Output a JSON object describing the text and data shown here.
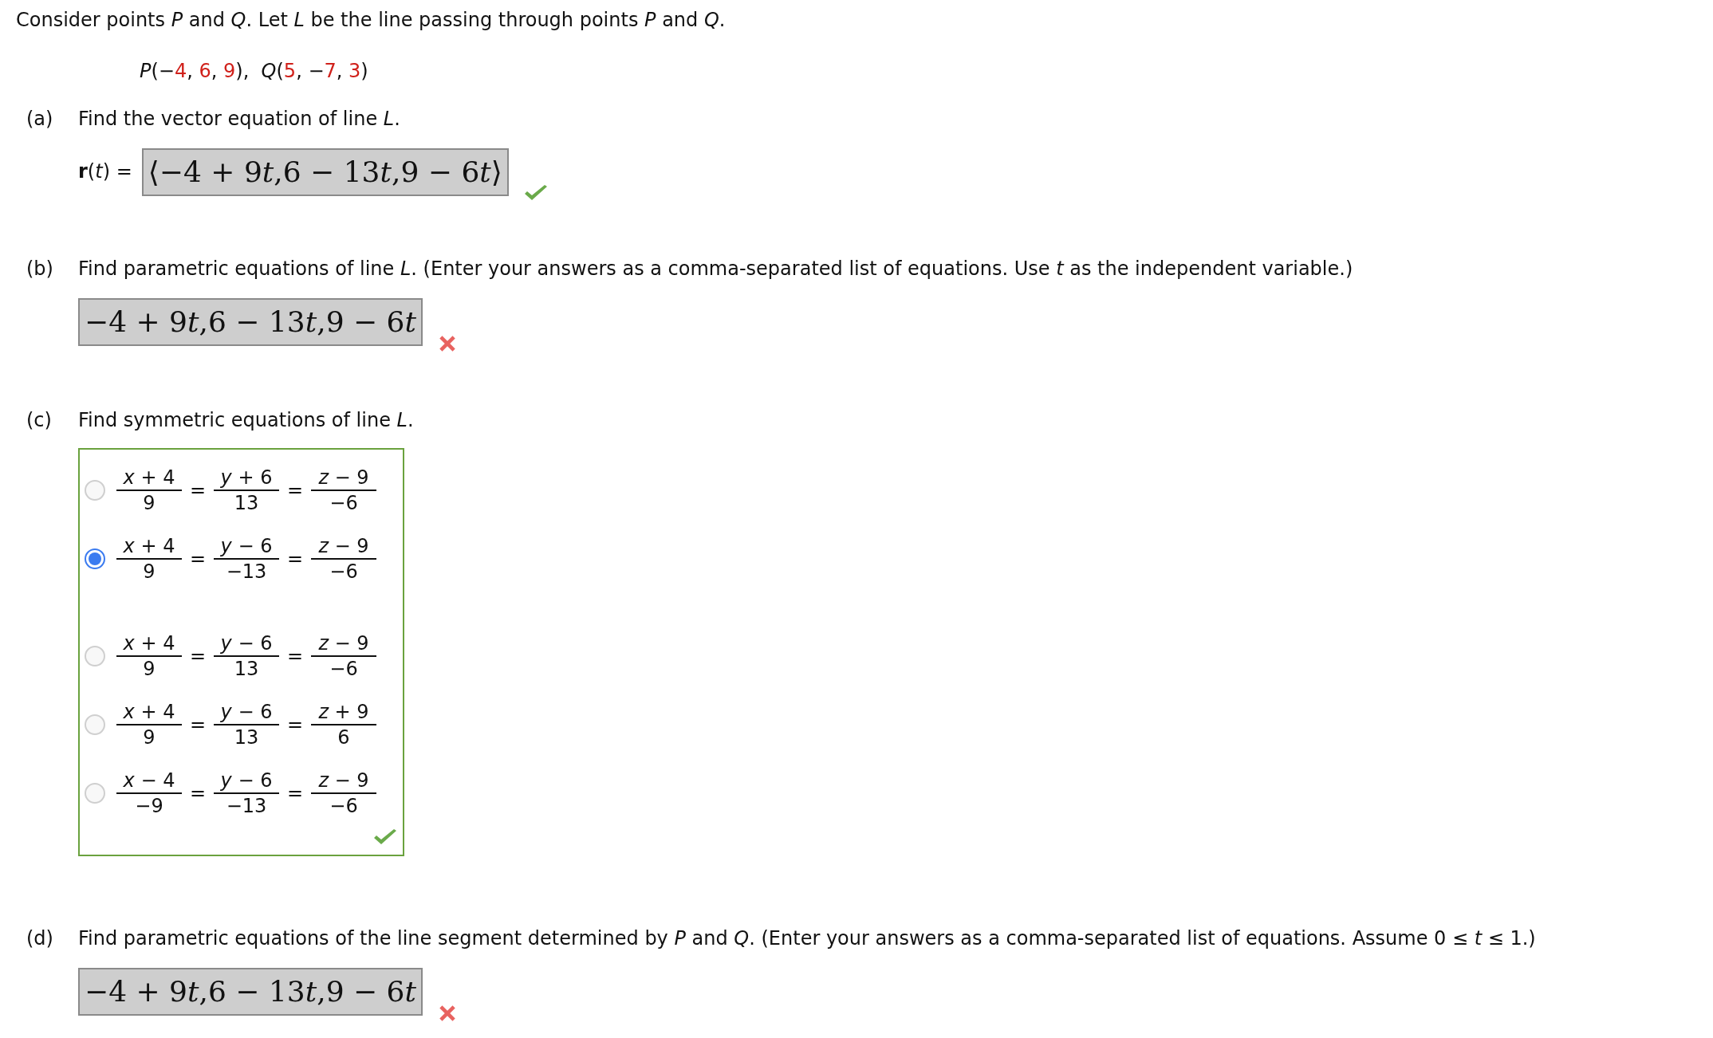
{
  "intro": "Consider points *P* and *Q*. Let *L* be the line passing through points *P* and *Q*.",
  "points": [
    {
      "kind": "plain",
      "text": "*P*(−"
    },
    {
      "kind": "value",
      "text": "4"
    },
    {
      "kind": "plain",
      "text": ", "
    },
    {
      "kind": "value",
      "text": "6"
    },
    {
      "kind": "plain",
      "text": ", "
    },
    {
      "kind": "value",
      "text": "9"
    },
    {
      "kind": "plain",
      "text": "),  *Q*("
    },
    {
      "kind": "value",
      "text": "5"
    },
    {
      "kind": "plain",
      "text": ", −"
    },
    {
      "kind": "value",
      "text": "7"
    },
    {
      "kind": "plain",
      "text": ", "
    },
    {
      "kind": "value",
      "text": "3"
    },
    {
      "kind": "plain",
      "text": ")"
    }
  ],
  "parts": [
    {
      "kind": "answer",
      "label": "(a)",
      "prompt": "Find the vector equation of line *L*.",
      "prefix": "**r**(*t*) =",
      "answer": [
        {
          "kind": "num",
          "text": "⟨−4 + 9"
        },
        {
          "kind": "var",
          "text": "t"
        },
        {
          "kind": "num",
          "text": ",6 − 13"
        },
        {
          "kind": "var",
          "text": "t"
        },
        {
          "kind": "num",
          "text": ",9 − 6"
        },
        {
          "kind": "var",
          "text": "t"
        },
        {
          "kind": "num",
          "text": "⟩"
        }
      ],
      "correct": true
    },
    {
      "kind": "answer",
      "label": "(b)",
      "prompt": "Find parametric equations of line *L*. (Enter your answers as a comma-separated list of equations. Use *t* as the independent variable.)",
      "answer": [
        {
          "kind": "num",
          "text": "−4 + 9"
        },
        {
          "kind": "var",
          "text": "t"
        },
        {
          "kind": "num",
          "text": ",6 − 13"
        },
        {
          "kind": "var",
          "text": "t"
        },
        {
          "kind": "num",
          "text": ",9 − 6"
        },
        {
          "kind": "var",
          "text": "t"
        }
      ],
      "correct": false
    },
    {
      "kind": "choice",
      "label": "(c)",
      "prompt": "Find symmetric equations of line *L*.",
      "correct": true,
      "options": [
        {
          "selected": false,
          "terms": [
            {
              "kind": "fraction",
              "numerator": "*x* + 4",
              "denominator": "9"
            },
            {
              "kind": "sign",
              "text": "="
            },
            {
              "kind": "fraction",
              "numerator": "*y* + 6",
              "denominator": "13"
            },
            {
              "kind": "sign",
              "text": "="
            },
            {
              "kind": "fraction",
              "numerator": "*z* − 9",
              "denominator": "−6"
            }
          ]
        },
        {
          "selected": true,
          "terms": [
            {
              "kind": "fraction",
              "numerator": "*x* + 4",
              "denominator": "9"
            },
            {
              "kind": "sign",
              "text": "="
            },
            {
              "kind": "fraction",
              "numerator": "*y* − 6",
              "denominator": "−13"
            },
            {
              "kind": "sign",
              "text": "="
            },
            {
              "kind": "fraction",
              "numerator": "*z* − 9",
              "denominator": "−6"
            }
          ]
        },
        {
          "selected": false,
          "terms": [
            {
              "kind": "fraction",
              "numerator": "*x* + 4",
              "denominator": "9"
            },
            {
              "kind": "sign",
              "text": "="
            },
            {
              "kind": "fraction",
              "numerator": "*y* − 6",
              "denominator": "13"
            },
            {
              "kind": "sign",
              "text": "="
            },
            {
              "kind": "fraction",
              "numerator": "*z* − 9",
              "denominator": "−6"
            }
          ]
        },
        {
          "selected": false,
          "terms": [
            {
              "kind": "fraction",
              "numerator": "*x* + 4",
              "denominator": "9"
            },
            {
              "kind": "sign",
              "text": "="
            },
            {
              "kind": "fraction",
              "numerator": "*y* − 6",
              "denominator": "13"
            },
            {
              "kind": "sign",
              "text": "="
            },
            {
              "kind": "fraction",
              "numerator": "*z* + 9",
              "denominator": "6"
            }
          ]
        },
        {
          "selected": false,
          "terms": [
            {
              "kind": "fraction",
              "numerator": "*x* − 4",
              "denominator": "−9"
            },
            {
              "kind": "sign",
              "text": "="
            },
            {
              "kind": "fraction",
              "numerator": "*y* − 6",
              "denominator": "−13"
            },
            {
              "kind": "sign",
              "text": "="
            },
            {
              "kind": "fraction",
              "numerator": "*z* − 9",
              "denominator": "−6"
            }
          ]
        }
      ]
    },
    {
      "kind": "answer",
      "label": "(d)",
      "prompt": "Find parametric equations of the line segment determined by *P* and *Q*. (Enter your answers as a comma-separated list of equations. Assume 0 ≤ *t* ≤ 1.)",
      "answer": [
        {
          "kind": "num",
          "text": "−4 + 9"
        },
        {
          "kind": "var",
          "text": "t"
        },
        {
          "kind": "num",
          "text": ",6 − 13"
        },
        {
          "kind": "var",
          "text": "t"
        },
        {
          "kind": "num",
          "text": ",9 − 6"
        },
        {
          "kind": "var",
          "text": "t"
        }
      ],
      "correct": false
    }
  ]
}
